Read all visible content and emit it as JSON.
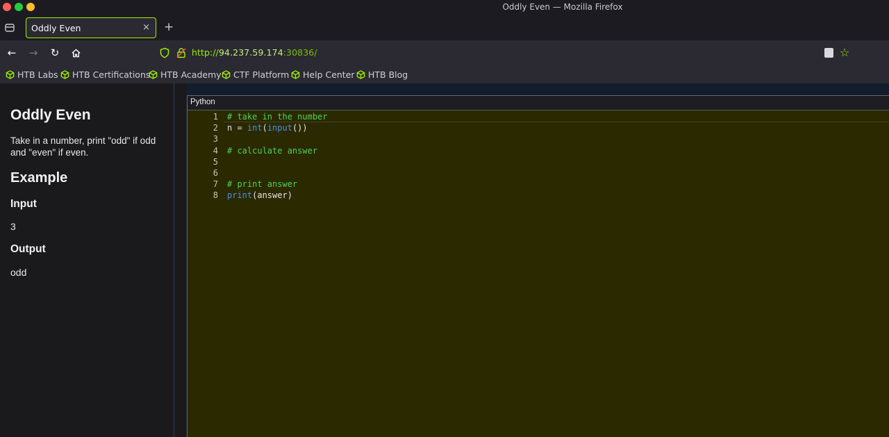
{
  "window": {
    "title": "Oddly Even — Mozilla Firefox"
  },
  "tabs": [
    {
      "label": "Oddly Even",
      "close": "×"
    }
  ],
  "newtab": "+",
  "nav": {
    "back": "←",
    "forward": "→",
    "reload": "↻",
    "home": "⌂",
    "url_scheme": "http://",
    "url_host": "94.237.59.174",
    "url_port": ":30836/",
    "star": "☆"
  },
  "bookmarks": [
    {
      "label": "HTB Labs"
    },
    {
      "label": "HTB Certifications"
    },
    {
      "label": "HTB Academy"
    },
    {
      "label": "CTF Platform"
    },
    {
      "label": "Help Center"
    },
    {
      "label": "HTB Blog"
    }
  ],
  "problem": {
    "title": "Oddly Even",
    "description": "Take in a number, print \"odd\" if odd and \"even\" if even.",
    "example_heading": "Example",
    "input_heading": "Input",
    "input_value": "3",
    "output_heading": "Output",
    "output_value": "odd"
  },
  "editor": {
    "language": "Python",
    "line_numbers": [
      "1",
      "2",
      "3",
      "4",
      "5",
      "6",
      "7",
      "8"
    ],
    "lines": [
      [
        {
          "t": "# take in the number",
          "k": "c-com"
        }
      ],
      [
        {
          "t": "n = ",
          "k": "c-txt"
        },
        {
          "t": "int",
          "k": "c-kw"
        },
        {
          "t": "(",
          "k": "c-txt"
        },
        {
          "t": "input",
          "k": "c-kw"
        },
        {
          "t": "())",
          "k": "c-txt"
        }
      ],
      [],
      [
        {
          "t": "# calculate answer",
          "k": "c-com"
        }
      ],
      [],
      [],
      [
        {
          "t": "# print answer",
          "k": "c-com"
        }
      ],
      [
        {
          "t": "print",
          "k": "c-kw"
        },
        {
          "t": "(answer)",
          "k": "c-txt"
        }
      ]
    ]
  },
  "colors": {
    "accent": "#9fef00",
    "editor_bg": "#2a2900",
    "comment": "#4ed35a",
    "keyword": "#4a90e2"
  }
}
